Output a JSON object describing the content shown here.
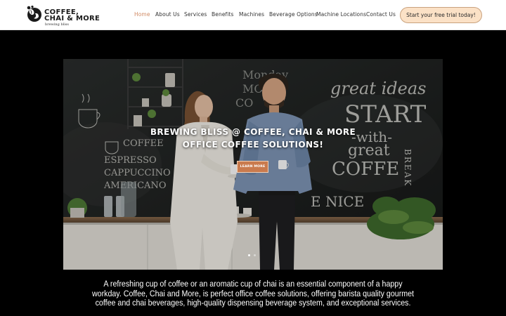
{
  "brand": {
    "line1": "COFFEE,",
    "line2": "CHAI & MORE",
    "tagline": "brewing bliss",
    "accent_color": "#d08a63",
    "cta_bg": "#fbe1c6"
  },
  "nav": {
    "items": [
      {
        "label": "Home",
        "active": true
      },
      {
        "label": "About Us"
      },
      {
        "label": "Services"
      },
      {
        "label": "Benefits"
      },
      {
        "label": "Machines"
      },
      {
        "label": "Beverage Options"
      },
      {
        "label": "Machine Locations"
      },
      {
        "label": "Contact Us"
      }
    ],
    "cta_label": "Start your free trial today!"
  },
  "hero": {
    "title_line1": "BREWING BLISS @ COFFEE, CHAI & MORE",
    "title_line2": "OFFICE COFFEE SOLUTIONS!",
    "button_label": "LEARN MORE",
    "slides": 2,
    "active_slide": 1,
    "chalkboard_text": {
      "top": "Monday",
      "more": "MORE",
      "coffee_small": "CO",
      "great_ideas": "great ideas",
      "start": "START",
      "with": "-with-",
      "great": "great",
      "coffe": "COFFE",
      "nice": "E NICE",
      "break": "BREAK",
      "coffee": "COFFEE",
      "espresso": "ESPRESSO",
      "cappuccino": "CAPPUCCINO",
      "americano": "AMERICANO"
    }
  },
  "intro": {
    "text": "A refreshing cup of coffee or an aromatic cup of chai is an essential component of a happy workday. Coffee, Chai and More, is perfect office coffee solutions, offering barista quality gourmet coffee and chai beverages, high-quality dispensing beverage system, and exceptional services."
  }
}
